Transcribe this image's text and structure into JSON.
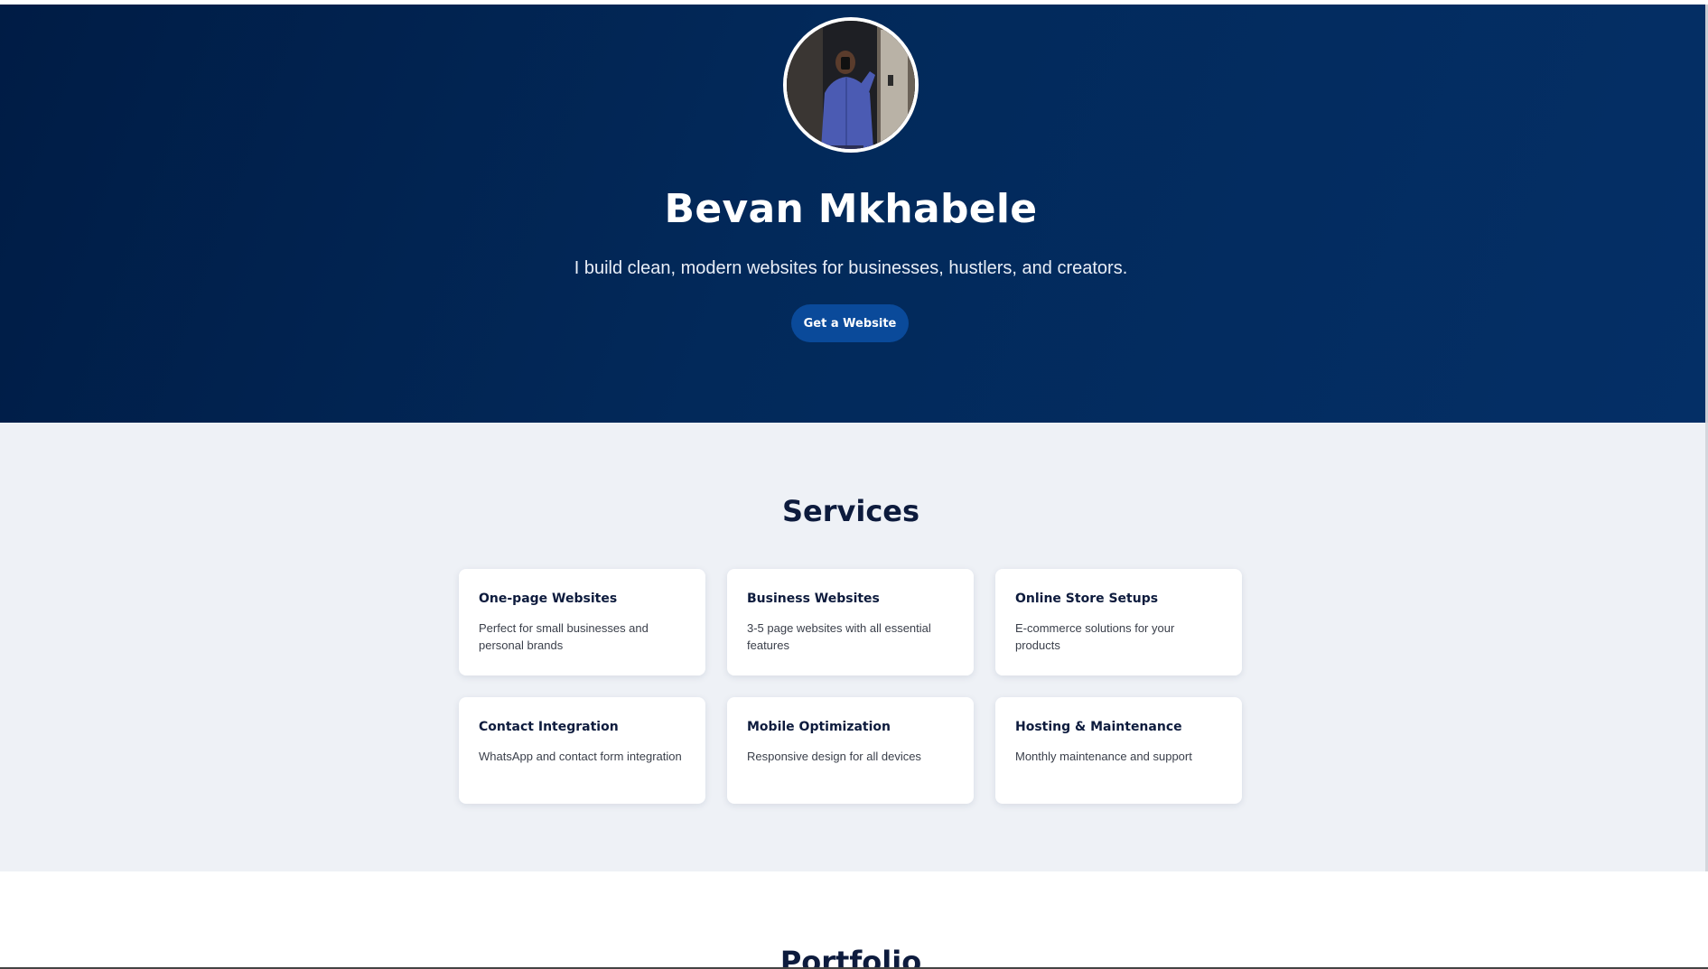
{
  "hero": {
    "name": "Bevan Mkhabele",
    "tagline": "I build clean, modern websites for businesses, hustlers, and creators.",
    "cta_label": "Get a Website",
    "avatar_icon": "profile-photo"
  },
  "services": {
    "title": "Services",
    "items": [
      {
        "title": "One-page Websites",
        "description": "Perfect for small businesses and personal brands"
      },
      {
        "title": "Business Websites",
        "description": "3-5 page websites with all essential features"
      },
      {
        "title": "Online Store Setups",
        "description": "E-commerce solutions for your products"
      },
      {
        "title": "Contact Integration",
        "description": "WhatsApp and contact form integration"
      },
      {
        "title": "Mobile Optimization",
        "description": "Responsive design for all devices"
      },
      {
        "title": "Hosting & Maintenance",
        "description": "Monthly maintenance and support"
      }
    ]
  },
  "portfolio": {
    "title": "Portfolio"
  },
  "colors": {
    "hero_bg": "#02295a",
    "accent_button": "#0a4a9a",
    "heading_text": "#0d1b3d",
    "section_bg": "#eef1f6",
    "card_bg": "#ffffff"
  }
}
